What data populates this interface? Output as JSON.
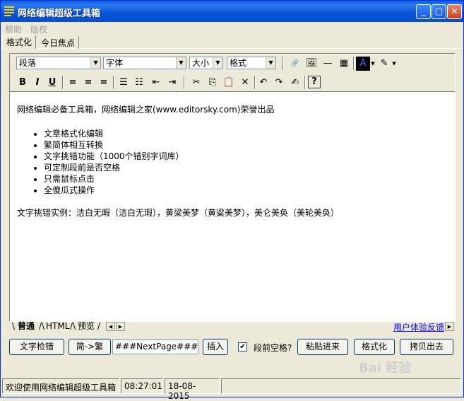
{
  "window": {
    "title": "网络编辑超级工具箱",
    "minimize": "_",
    "maximize": "□",
    "close": "✕"
  },
  "menu": {
    "help": "帮助",
    "copyright": "版权"
  },
  "tabs": {
    "format": "格式化",
    "today": "今日焦点"
  },
  "toolbar": {
    "paragraph": "段落",
    "font": "字体",
    "size": "大小",
    "format": "格式",
    "bold": "B",
    "italic": "I",
    "underline": "U"
  },
  "editor": {
    "intro": "网络编辑必备工具箱，网络编辑之家(www.editorsky.com)荣誉出品",
    "features": [
      "文章格式化编辑",
      "繁简体相互转换",
      "文字挑错功能（1000个错别字词库）",
      "可定制段前是否空格",
      "只需鼠标点击",
      "全傻瓜式操作"
    ],
    "example": "文字挑错实例：洁白无暇（洁白无瑕），黄梁美梦（黄粱美梦），美仑美奂（美轮美奂）"
  },
  "view_tabs": {
    "normal": "普通",
    "html": "HTML",
    "preview": "预览"
  },
  "feedback_link": "用户体验反馈",
  "actions": {
    "check": "文字检错",
    "convert": "简->繁",
    "nextpage_value": "###NextPage###",
    "insert": "插入",
    "space_before_label": "段前空格?",
    "space_before_checked": true,
    "paste": "粘贴进来",
    "format": "格式化",
    "copy_out": "拷贝出去"
  },
  "status": {
    "welcome": "欢迎使用网络编辑超级工具箱",
    "time": "08:27:01",
    "date": "18-08-2015"
  },
  "watermark": "Bai 经验"
}
